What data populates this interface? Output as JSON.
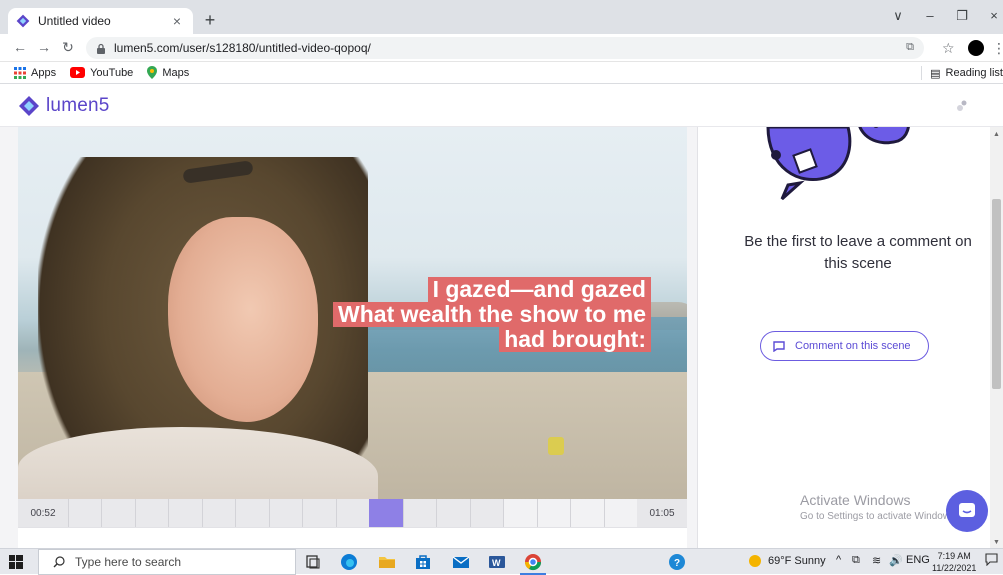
{
  "browser": {
    "tab_title": "Untitled video",
    "tab_close": "×",
    "new_tab": "+",
    "url": "lumen5.com/user/s128180/untitled-video-qopoq/",
    "window_minimize": "–",
    "window_restore": "❐",
    "window_close": "×",
    "window_menu": "∨",
    "more_menu": "⋮"
  },
  "bookmarks": {
    "items": [
      {
        "label": "Apps",
        "icon": "apps-grid-icon"
      },
      {
        "label": "YouTube",
        "icon": "youtube-icon"
      },
      {
        "label": "Maps",
        "icon": "maps-pin-icon"
      }
    ],
    "reading_list": "Reading list"
  },
  "app": {
    "logo_text": "lumen5",
    "brand_color": "#5b45c9"
  },
  "video": {
    "caption_lines": [
      "I gazed—and gazed",
      "What wealth the show to me",
      "had brought:"
    ],
    "caption_bg": "#e06a6a",
    "time_start": "00:52",
    "time_end": "01:05",
    "frames_total": 17,
    "active_frame_index": 9
  },
  "comments": {
    "empty_message": "Be the first to leave a comment on this scene",
    "button_label": "Comment on this scene"
  },
  "watermark": {
    "title": "Activate Windows",
    "subtitle": "Go to Settings to activate Windows."
  },
  "taskbar": {
    "search_placeholder": "Type here to search",
    "weather": "69°F  Sunny",
    "language": "ENG",
    "time": "7:19 AM",
    "date": "11/22/2021"
  }
}
